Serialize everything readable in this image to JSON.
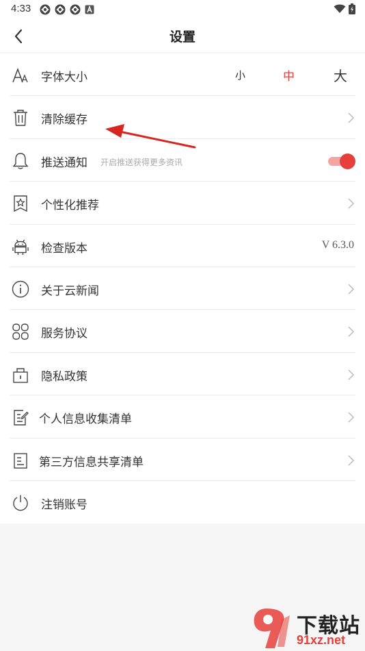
{
  "status_bar": {
    "time": "4:33",
    "left_icons": [
      "app-notification-icon",
      "app-notification-icon",
      "app-notification-icon",
      "a-badge-icon"
    ],
    "right_icons": [
      "wifi-icon",
      "battery-charging-icon"
    ]
  },
  "header": {
    "title": "设置"
  },
  "settings": {
    "font_size": {
      "label": "字体大小",
      "options": [
        "小",
        "中",
        "大"
      ],
      "selected": "中"
    },
    "clear_cache": {
      "label": "清除缓存"
    },
    "push": {
      "label": "推送通知",
      "hint": "开启推送获得更多资讯",
      "enabled": true
    },
    "personalized": {
      "label": "个性化推荐"
    },
    "check_version": {
      "label": "检查版本",
      "version": "V 6.3.0"
    },
    "about": {
      "label": "关于云新闻"
    },
    "service": {
      "label": "服务协议"
    },
    "privacy": {
      "label": "隐私政策"
    },
    "personal_info": {
      "label": "个人信息收集清单"
    },
    "third_party": {
      "label": "第三方信息共享清单"
    },
    "logout": {
      "label": "注销账号"
    }
  },
  "watermark": {
    "title": "下载站",
    "url": "91xz.net"
  },
  "colors": {
    "accent": "#e5403b",
    "background": "#f5f5f5",
    "card": "#ffffff"
  }
}
